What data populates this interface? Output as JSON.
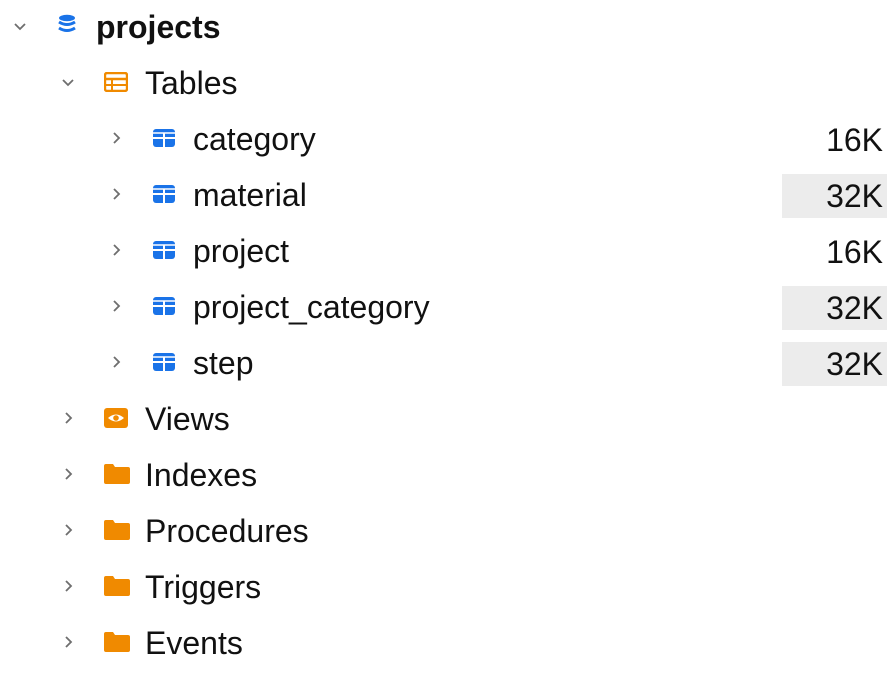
{
  "tree": {
    "database": {
      "label": "projects",
      "icon": "database-icon",
      "color": "#1a73e8"
    },
    "tables_group": {
      "label": "Tables",
      "icon": "table-group-icon",
      "color": "#f08a00"
    },
    "tables": [
      {
        "label": "category",
        "size": "16K"
      },
      {
        "label": "material",
        "size": "32K"
      },
      {
        "label": "project",
        "size": "16K"
      },
      {
        "label": "project_category",
        "size": "32K"
      },
      {
        "label": "step",
        "size": "32K"
      }
    ],
    "folders": [
      {
        "label": "Views",
        "icon": "eye-icon"
      },
      {
        "label": "Indexes",
        "icon": "folder-icon"
      },
      {
        "label": "Procedures",
        "icon": "folder-icon"
      },
      {
        "label": "Triggers",
        "icon": "folder-icon"
      },
      {
        "label": "Events",
        "icon": "folder-icon"
      }
    ],
    "colors": {
      "table_icon": "#1a73e8",
      "folder_icon": "#f08a00",
      "size_shade": "#ececec"
    }
  }
}
